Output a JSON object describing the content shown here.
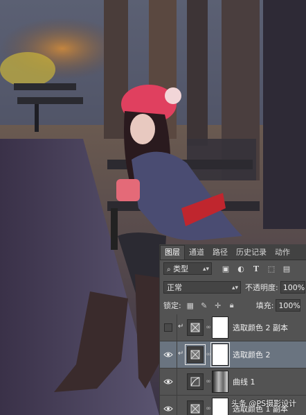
{
  "tabs": [
    "图层",
    "通道",
    "路径",
    "历史记录",
    "动作"
  ],
  "filter": {
    "kind_label": "类型"
  },
  "blend": {
    "mode": "正常",
    "opacity_label": "不透明度:",
    "opacity_value": "100%"
  },
  "lock": {
    "label": "锁定:",
    "fill_label": "填充:",
    "fill_value": "100%"
  },
  "layers": [
    {
      "name": "选取颜色 2 副本",
      "type": "selective-color",
      "visible": false,
      "clipped": true
    },
    {
      "name": "选取颜色 2",
      "type": "selective-color",
      "visible": true,
      "clipped": true,
      "selected": true
    },
    {
      "name": "曲线 1",
      "type": "curves",
      "visible": true,
      "clipped": false
    },
    {
      "name": "选取颜色 1 副本",
      "type": "selective-color",
      "visible": true,
      "clipped": false
    }
  ],
  "watermark": "头条 @PS摄影设计",
  "colors": {
    "panel_bg": "#535353",
    "tab_bg": "#424242",
    "selected_row": "#6a7480",
    "hat": "#e0405f",
    "dress": "#4a4c72",
    "belt": "#c0262e"
  }
}
